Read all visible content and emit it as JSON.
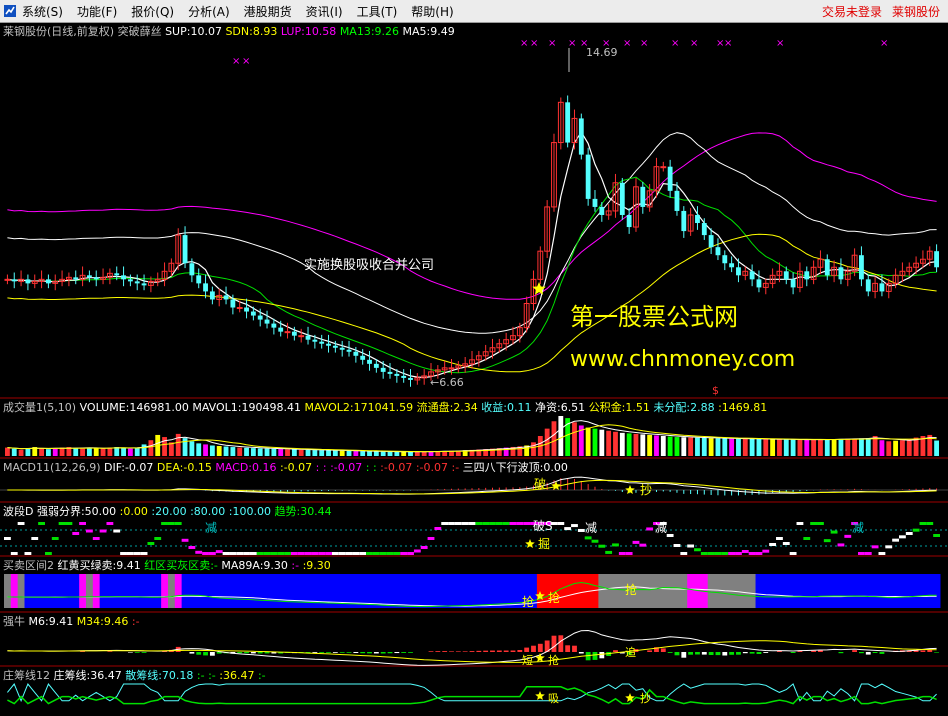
{
  "menubar": {
    "items": [
      "系统(S)",
      "功能(F)",
      "报价(Q)",
      "分析(A)",
      "港股期货",
      "资讯(I)",
      "工具(T)",
      "帮助(H)"
    ],
    "status_login": "交易未登录",
    "status_stock": "莱钢股份"
  },
  "colors": {
    "up": "#ff3232",
    "down": "#54ffff",
    "white": "#ffffff",
    "yellow": "#ffff00",
    "magenta": "#ff00ff",
    "green": "#00e000",
    "ma_mid": "#c040c0",
    "label": "#c0c0c0"
  },
  "panels": [
    {
      "id": "price",
      "header": [
        {
          "t": "莱钢股份(日线,前复权) 突破薛丝",
          "c": "#c0c0c0"
        },
        {
          "t": "SUP:10.07",
          "c": "#ffffff"
        },
        {
          "t": "SDN:8.93",
          "c": "#ffff00"
        },
        {
          "t": "LUP:10.58",
          "c": "#ff00ff"
        },
        {
          "t": "MA13:9.26",
          "c": "#00ff00"
        },
        {
          "t": "MA5:9.49",
          "c": "#ffffff"
        }
      ]
    },
    {
      "id": "volume",
      "header": [
        {
          "t": "成交量1(5,10)",
          "c": "#c0c0c0"
        },
        {
          "t": "VOLUME:146981.00",
          "c": "#ffffff"
        },
        {
          "t": "MAVOL1:190498.41",
          "c": "#ffffff"
        },
        {
          "t": "MAVOL2:171041.59",
          "c": "#ffff00"
        },
        {
          "t": "流通盘:2.34",
          "c": "#ffff00"
        },
        {
          "t": "收益:0.11",
          "c": "#54ffff"
        },
        {
          "t": "净资:6.51",
          "c": "#ffffff"
        },
        {
          "t": "公积金:1.51",
          "c": "#ffff00"
        },
        {
          "t": "未分配:2.88",
          "c": "#54ffff"
        },
        {
          "t": ":1469.81",
          "c": "#ffff00"
        }
      ]
    },
    {
      "id": "macd",
      "header": [
        {
          "t": "MACD11(12,26,9)",
          "c": "#c0c0c0"
        },
        {
          "t": "DIF:-0.07",
          "c": "#ffffff"
        },
        {
          "t": "DEA:-0.15",
          "c": "#ffff00"
        },
        {
          "t": "MACD:0.16",
          "c": "#ff00ff"
        },
        {
          "t": ":-0.07",
          "c": "#ffff00"
        },
        {
          "t": ": :",
          "c": "#ff00ff"
        },
        {
          "t": ":-0.07",
          "c": "#ff00ff"
        },
        {
          "t": ": :",
          "c": "#00ff00"
        },
        {
          "t": ":-0.07",
          "c": "#ff3232"
        },
        {
          "t": ":-0.07",
          "c": "#ff3232"
        },
        {
          "t": ":-",
          "c": "#ff3232"
        },
        {
          "t": "三四八下行波顶:0.00",
          "c": "#ffffff"
        }
      ]
    },
    {
      "id": "wave",
      "header": [
        {
          "t": "波段D 强弱分界:50.00",
          "c": "#ffffff"
        },
        {
          "t": ":0.00",
          "c": "#ffff00"
        },
        {
          "t": ":20.00",
          "c": "#54ffff"
        },
        {
          "t": ":80.00",
          "c": "#54ffff"
        },
        {
          "t": ":100.00",
          "c": "#54ffff"
        },
        {
          "t": "趋势:30.44",
          "c": "#00ff00"
        }
      ]
    },
    {
      "id": "buysell",
      "header": [
        {
          "t": "买卖区间2",
          "c": "#c0c0c0"
        },
        {
          "t": "红黄买绿卖:9.41",
          "c": "#ffffff"
        },
        {
          "t": "红区买灰区卖:-",
          "c": "#00ff00"
        },
        {
          "t": "MA89A:9.30",
          "c": "#ffffff"
        },
        {
          "t": ":-",
          "c": "#ff00ff"
        },
        {
          "t": ":9.30",
          "c": "#ffff00"
        }
      ]
    },
    {
      "id": "bull",
      "header": [
        {
          "t": "强牛",
          "c": "#c0c0c0"
        },
        {
          "t": "M6:9.41",
          "c": "#ffffff"
        },
        {
          "t": "M34:9.46",
          "c": "#ffff00"
        },
        {
          "t": ":-",
          "c": "#ff3232"
        }
      ]
    },
    {
      "id": "banker",
      "header": [
        {
          "t": "庄筹线12",
          "c": "#c0c0c0"
        },
        {
          "t": "庄筹线:36.47",
          "c": "#ffffff"
        },
        {
          "t": "散筹线:70.18",
          "c": "#54ffff"
        },
        {
          "t": ":-",
          "c": "#00ff00"
        },
        {
          "t": ":-",
          "c": "#00ff00"
        },
        {
          "t": ":36.47",
          "c": "#ffff00"
        },
        {
          "t": ":-",
          "c": "#00ff00"
        }
      ]
    }
  ],
  "annotations": {
    "high_label": "14.69",
    "low_label": "←6.66",
    "merger_note": "实施换股吸收合并公司",
    "watermark_title": "第一股票公式网",
    "watermark_url": "www.chnmoney.com",
    "volume_marker": "$",
    "macd_marks": [
      "破",
      "抄"
    ],
    "wave_marks": [
      "减",
      "破S",
      "减",
      "减",
      "减",
      "掘"
    ],
    "buysell_marks": [
      "抢",
      "抢",
      "抢"
    ],
    "bull_marks": [
      "短",
      "抢",
      "追"
    ],
    "banker_marks": [
      "吸",
      "抄"
    ]
  },
  "chart_data": {
    "type": "candlestick",
    "title": "莱钢股份(日线,前复权) 突破薛丝",
    "price_range": [
      6.4,
      15.0
    ],
    "price_high": 14.69,
    "price_low": 6.66,
    "indicators_last": {
      "SUP": 10.07,
      "SDN": 8.93,
      "LUP": 10.58,
      "MA13": 9.26,
      "MA5": 9.49
    },
    "close": [
      9.2,
      9.15,
      9.2,
      9.1,
      9.15,
      9.2,
      9.1,
      9.15,
      9.2,
      9.25,
      9.2,
      9.3,
      9.25,
      9.2,
      9.25,
      9.35,
      9.3,
      9.2,
      9.15,
      9.1,
      9.05,
      9.15,
      9.2,
      9.4,
      9.6,
      10.3,
      9.6,
      9.3,
      9.1,
      8.9,
      8.7,
      8.8,
      8.7,
      8.5,
      8.5,
      8.4,
      8.3,
      8.2,
      8.1,
      8.0,
      7.9,
      7.9,
      7.8,
      7.8,
      7.7,
      7.65,
      7.6,
      7.55,
      7.5,
      7.45,
      7.4,
      7.3,
      7.2,
      7.1,
      7.0,
      6.9,
      6.85,
      6.8,
      6.75,
      6.7,
      6.75,
      6.8,
      6.9,
      6.95,
      7.0,
      7.0,
      7.05,
      7.1,
      7.2,
      7.3,
      7.4,
      7.5,
      7.6,
      7.7,
      7.8,
      8.0,
      8.6,
      9.2,
      9.9,
      11.0,
      12.6,
      13.6,
      12.6,
      13.2,
      12.3,
      11.2,
      11.0,
      10.8,
      10.9,
      11.6,
      10.8,
      10.5,
      11.5,
      11.0,
      11.4,
      12.0,
      12.0,
      11.4,
      10.9,
      10.4,
      10.8,
      10.6,
      10.3,
      10.0,
      9.8,
      9.6,
      9.5,
      9.3,
      9.4,
      9.2,
      9.0,
      9.1,
      9.3,
      9.4,
      9.2,
      9.0,
      9.4,
      9.2,
      9.5,
      9.7,
      9.3,
      9.5,
      9.2,
      9.4,
      9.8,
      9.2,
      8.9,
      9.1,
      8.9,
      9.1,
      9.3,
      9.4,
      9.5,
      9.6,
      9.7,
      9.9,
      9.5
    ],
    "volume": [
      80,
      70,
      60,
      75,
      85,
      70,
      65,
      70,
      80,
      85,
      75,
      70,
      80,
      75,
      70,
      80,
      85,
      75,
      70,
      80,
      110,
      150,
      200,
      180,
      130,
      210,
      170,
      140,
      120,
      110,
      100,
      95,
      90,
      85,
      80,
      78,
      75,
      72,
      70,
      68,
      66,
      64,
      62,
      60,
      58,
      56,
      55,
      54,
      52,
      50,
      48,
      46,
      45,
      44,
      43,
      42,
      41,
      40,
      40,
      41,
      42,
      43,
      44,
      45,
      48,
      50,
      52,
      55,
      58,
      62,
      66,
      70,
      75,
      80,
      86,
      92,
      100,
      130,
      190,
      260,
      330,
      380,
      360,
      320,
      290,
      270,
      260,
      250,
      240,
      230,
      220,
      215,
      210,
      205,
      200,
      195,
      190,
      185,
      180,
      178,
      176,
      174,
      172,
      170,
      168,
      166,
      165,
      164,
      163,
      162,
      161,
      160,
      159,
      158,
      157,
      156,
      155,
      155,
      156,
      157,
      158,
      160,
      162,
      164,
      166,
      168,
      170,
      190,
      150,
      140,
      145,
      150,
      160,
      175,
      190,
      200,
      147
    ]
  }
}
